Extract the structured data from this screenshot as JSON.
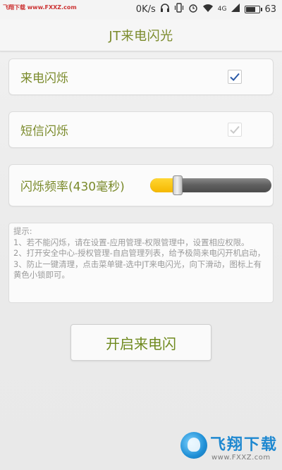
{
  "status_bar": {
    "time": "",
    "watermark_url": "飞翔下载 www.FXXZ.com",
    "net_speed": "0K/s",
    "network": "4G",
    "battery_level": "63"
  },
  "header": {
    "title": "JT来电闪光"
  },
  "settings": {
    "call_flash_label": "来电闪烁",
    "call_flash_checked": true,
    "sms_flash_label": "短信闪烁",
    "sms_flash_checked": true,
    "frequency_label": "闪烁频率(430毫秒)",
    "frequency_slider_value": 0.2
  },
  "hint": {
    "title": "提示:",
    "lines": [
      "1、若不能闪烁，请在设置-应用管理-权限管理中，设置相应权限。",
      "2、打开安全中心-授权管理-自启管理列表，给予极简来电闪开机启动，",
      "3、防止一键清理，点击菜单键-选中JT来电闪光，向下滑动，图标上有黄色小锁即可。"
    ]
  },
  "actions": {
    "start_label": "开启来电闪"
  },
  "watermark": {
    "brand": "飞翔下载",
    "url": "www.FXXZ.com"
  },
  "colors": {
    "accent_text": "#7a8a2a",
    "checkbox_check": "#2b5aa8",
    "slider_fill": "#f5b800"
  }
}
